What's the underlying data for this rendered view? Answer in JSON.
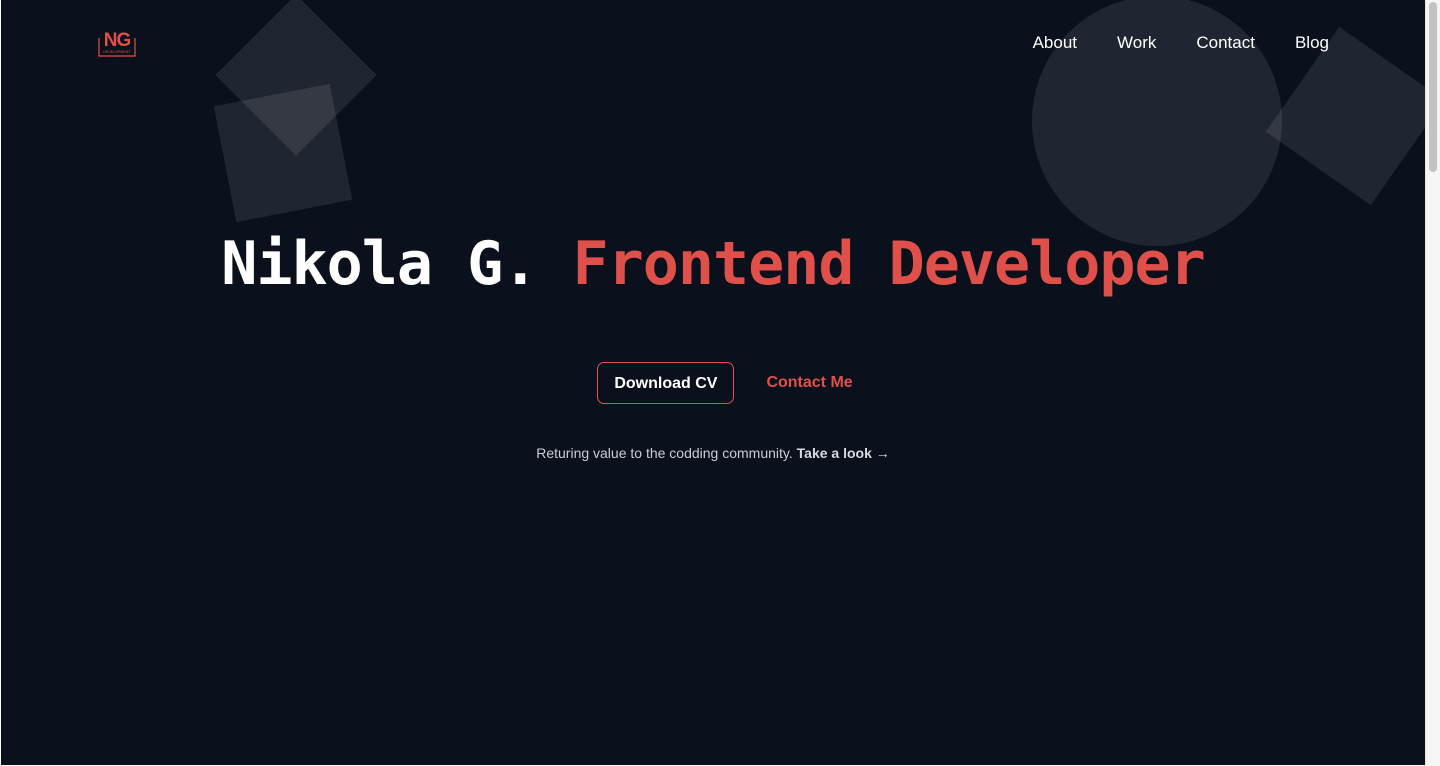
{
  "logo": {
    "initials": "NG",
    "subtitle": "DEVELOPMENT",
    "color": "#e0504a"
  },
  "nav": {
    "items": [
      {
        "label": "About"
      },
      {
        "label": "Work"
      },
      {
        "label": "Contact"
      },
      {
        "label": "Blog"
      }
    ]
  },
  "hero": {
    "name": "Nikola G.",
    "role": "Frontend Developer",
    "accent_color": "#e0504a",
    "background_color": "#0a111d"
  },
  "actions": {
    "download_cv_label": "Download CV",
    "contact_me_label": "Contact Me"
  },
  "tagline": {
    "text": "Returing value to the codding community.",
    "link_label": "Take a look →"
  }
}
